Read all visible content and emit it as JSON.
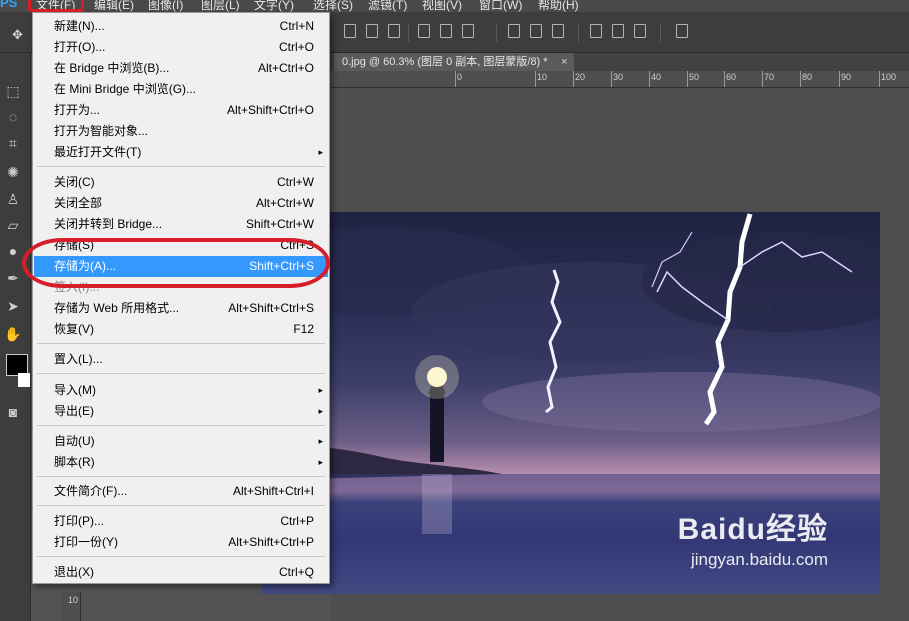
{
  "app": {
    "logo": "PS"
  },
  "menubar": {
    "items": [
      {
        "label": "文件(F)"
      },
      {
        "label": "编辑(E)"
      },
      {
        "label": "图像(I)"
      },
      {
        "label": "图层(L)"
      },
      {
        "label": "文字(Y)"
      },
      {
        "label": "选择(S)"
      },
      {
        "label": "滤镜(T)"
      },
      {
        "label": "视图(V)"
      },
      {
        "label": "窗口(W)"
      },
      {
        "label": "帮助(H)"
      }
    ]
  },
  "document": {
    "tab_title": "0.jpg @ 60.3% (图层 0 副本, 图层蒙版/8) *",
    "close_glyph": "×"
  },
  "ruler": {
    "h_labels": [
      "0",
      "10",
      "20",
      "30",
      "40",
      "50",
      "60",
      "70",
      "80",
      "90",
      "100"
    ],
    "v_label": "10"
  },
  "file_menu": {
    "items": [
      {
        "label": "新建(N)...",
        "shortcut": "Ctrl+N"
      },
      {
        "label": "打开(O)...",
        "shortcut": "Ctrl+O"
      },
      {
        "label": "在 Bridge 中浏览(B)...",
        "shortcut": "Alt+Ctrl+O"
      },
      {
        "label": "在 Mini Bridge 中浏览(G)...",
        "shortcut": ""
      },
      {
        "label": "打开为...",
        "shortcut": "Alt+Shift+Ctrl+O"
      },
      {
        "label": "打开为智能对象...",
        "shortcut": ""
      },
      {
        "label": "最近打开文件(T)",
        "shortcut": "",
        "submenu": "▸"
      },
      {
        "label": "关闭(C)",
        "shortcut": "Ctrl+W"
      },
      {
        "label": "关闭全部",
        "shortcut": "Alt+Ctrl+W"
      },
      {
        "label": "关闭并转到 Bridge...",
        "shortcut": "Shift+Ctrl+W"
      },
      {
        "label": "存储(S)",
        "shortcut": "Ctrl+S"
      },
      {
        "label": "存储为(A)...",
        "shortcut": "Shift+Ctrl+S"
      },
      {
        "label": "签入(I)...",
        "shortcut": ""
      },
      {
        "label": "存储为 Web 所用格式...",
        "shortcut": "Alt+Shift+Ctrl+S"
      },
      {
        "label": "恢复(V)",
        "shortcut": "F12"
      },
      {
        "label": "置入(L)...",
        "shortcut": ""
      },
      {
        "label": "导入(M)",
        "shortcut": "",
        "submenu": "▸"
      },
      {
        "label": "导出(E)",
        "shortcut": "",
        "submenu": "▸"
      },
      {
        "label": "自动(U)",
        "shortcut": "",
        "submenu": "▸"
      },
      {
        "label": "脚本(R)",
        "shortcut": "",
        "submenu": "▸"
      },
      {
        "label": "文件简介(F)...",
        "shortcut": "Alt+Shift+Ctrl+I"
      },
      {
        "label": "打印(P)...",
        "shortcut": "Ctrl+P"
      },
      {
        "label": "打印一份(Y)",
        "shortcut": "Alt+Shift+Ctrl+P"
      },
      {
        "label": "退出(X)",
        "shortcut": "Ctrl+Q"
      }
    ],
    "selected_index": 11
  },
  "watermark": {
    "logo": "Baidu经验",
    "url": "jingyan.baidu.com"
  },
  "colors": {
    "highlight_red": "#d61e2b",
    "menu_selected": "#3399ff",
    "ps_blue": "#31a8ff"
  },
  "icons": [
    "move-tool-icon",
    "marquee-icon",
    "lasso-icon",
    "crop-icon",
    "healing-icon",
    "stamp-icon",
    "eraser-icon",
    "blur-icon",
    "pen-icon",
    "path-select-icon",
    "hand-icon",
    "quick-mask-icon"
  ]
}
